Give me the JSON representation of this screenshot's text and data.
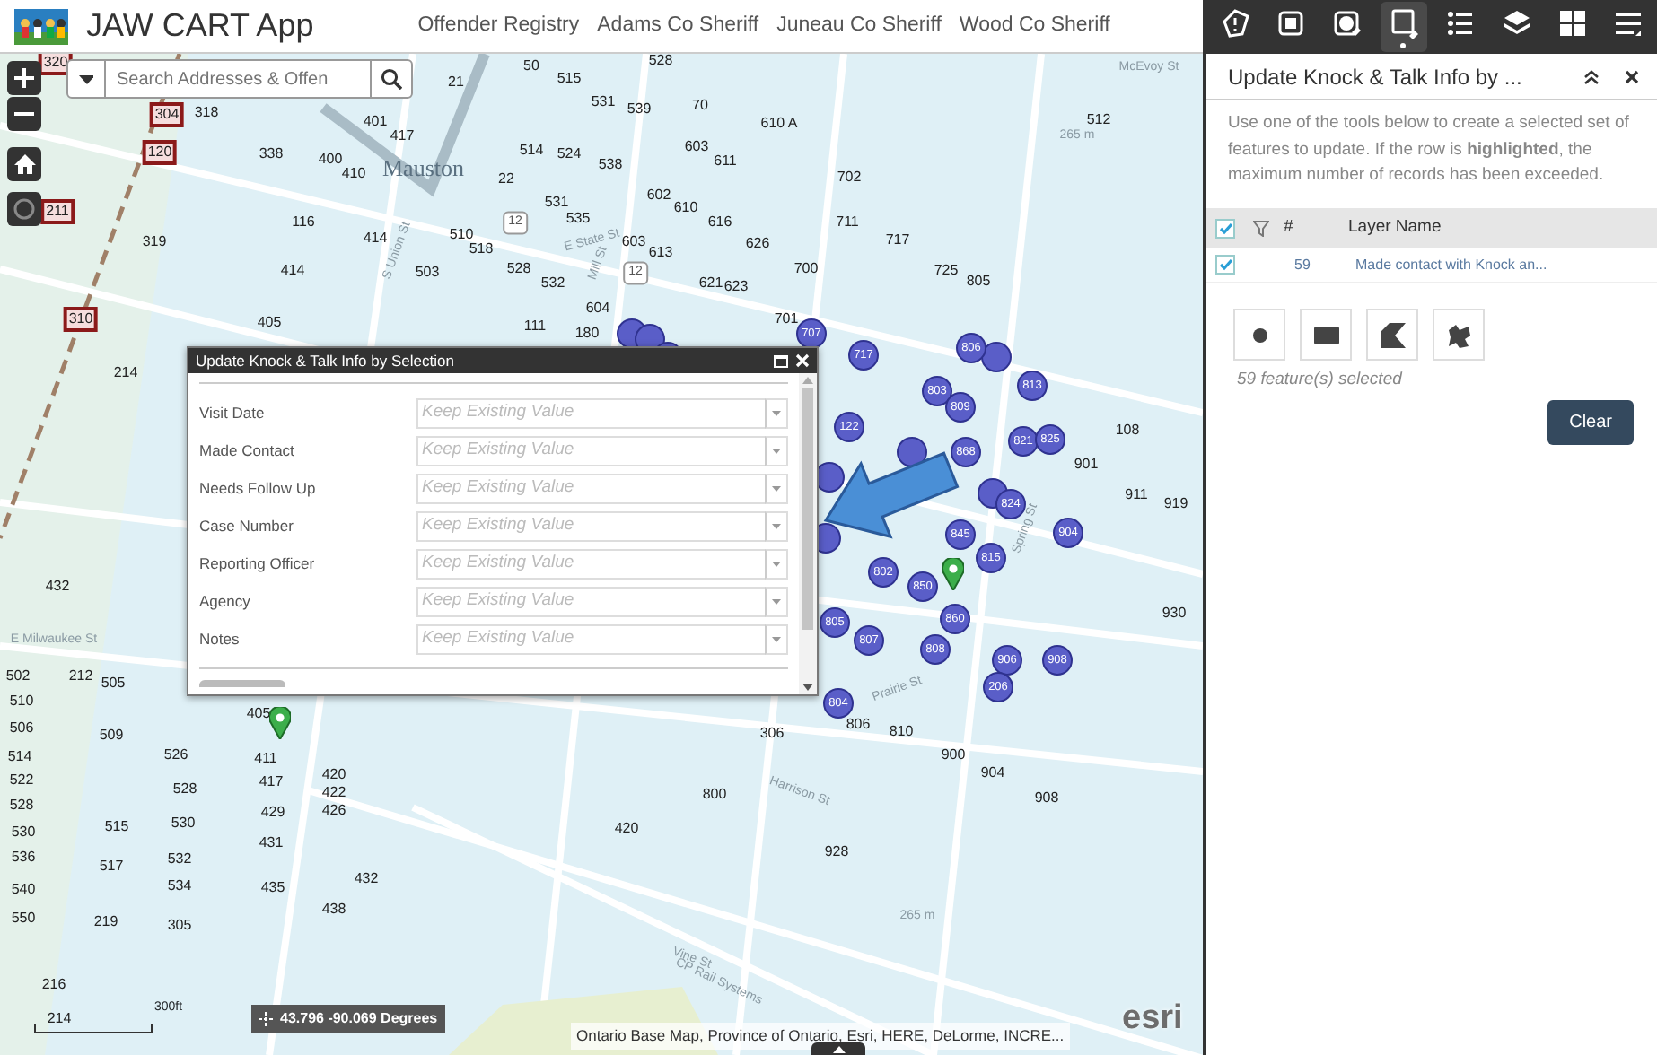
{
  "header": {
    "app_title": "JAW CART App",
    "links": [
      "Offender Registry",
      "Adams Co Sheriff",
      "Juneau Co Sheriff",
      "Wood Co Sheriff"
    ]
  },
  "search": {
    "placeholder": "Search Addresses & Offen"
  },
  "map": {
    "place_label": "Mauston",
    "parcel_labels": [
      "50",
      "515",
      "528",
      "21",
      "531",
      "539",
      "70",
      "610 A",
      "512",
      "318",
      "401",
      "417",
      "338",
      "400",
      "410",
      "514",
      "524",
      "538",
      "603",
      "611",
      "22",
      "702",
      "602",
      "610",
      "531",
      "535",
      "319",
      "116",
      "414",
      "510",
      "518",
      "616",
      "711",
      "414",
      "503",
      "528",
      "603",
      "613",
      "626",
      "717",
      "532",
      "621",
      "623",
      "700",
      "725",
      "805",
      "405",
      "111",
      "604",
      "180",
      "701",
      "214",
      "108",
      "901",
      "911",
      "919",
      "930",
      "432",
      "502",
      "212",
      "505",
      "510",
      "506",
      "509",
      "514",
      "522",
      "528",
      "530",
      "536",
      "540",
      "550",
      "526",
      "528",
      "530",
      "532",
      "534",
      "305",
      "515",
      "517",
      "219",
      "405",
      "411",
      "417",
      "420",
      "422",
      "429",
      "426",
      "431",
      "435",
      "432",
      "438",
      "420",
      "800",
      "306",
      "806",
      "810",
      "900",
      "904",
      "908",
      "928",
      "216",
      "214"
    ],
    "boxed_labels": [
      "320",
      "304",
      "120",
      "211",
      "310"
    ],
    "marker_labels": [
      "707",
      "717",
      "806",
      "803",
      "809",
      "813",
      "821",
      "825",
      "122",
      "868",
      "824",
      "845",
      "815",
      "802",
      "850",
      "860",
      "805",
      "807",
      "808",
      "906",
      "908",
      "206",
      "804",
      "904"
    ],
    "street_labels": [
      "McEvoy St",
      "E State St",
      "S Union St",
      "Mill St",
      "E Milwaukee St",
      "Prairie St",
      "Harrison St",
      "Vine St",
      "CP Rail Systems",
      "Spring St"
    ],
    "contour_labels": [
      "265 m",
      "265 m"
    ],
    "highway_shields": [
      "12",
      "12"
    ],
    "scale": "300ft",
    "coordinates": "43.796 -90.069 Degrees",
    "attribution": "Ontario Base Map, Province of Ontario, Esri, HERE, DeLorme, INCRE...",
    "logo": "esri"
  },
  "popup": {
    "title": "Update Knock & Talk Info by Selection",
    "fields": [
      {
        "label": "Visit Date",
        "placeholder": "Keep Existing Value"
      },
      {
        "label": "Made Contact",
        "placeholder": "Keep Existing Value"
      },
      {
        "label": "Needs Follow Up",
        "placeholder": "Keep Existing Value"
      },
      {
        "label": "Case Number",
        "placeholder": "Keep Existing Value"
      },
      {
        "label": "Reporting Officer",
        "placeholder": "Keep Existing Value"
      },
      {
        "label": "Agency",
        "placeholder": "Keep Existing Value"
      },
      {
        "label": "Notes",
        "placeholder": "Keep Existing Value"
      }
    ]
  },
  "toolbar": [
    {
      "kind": "about",
      "selected": false
    },
    {
      "kind": "edit",
      "selected": false
    },
    {
      "kind": "select",
      "selected": false
    },
    {
      "kind": "update",
      "selected": true
    },
    {
      "kind": "legend",
      "selected": false
    },
    {
      "kind": "layers",
      "selected": false
    },
    {
      "kind": "grid",
      "selected": false
    },
    {
      "kind": "list",
      "selected": false
    }
  ],
  "panel": {
    "title": "Update Knock & Talk Info by ...",
    "description": "Use one of the tools below to create a selected set of features to update. If the row is **highlighted**, the maximum number of records has been exceeded.",
    "table": {
      "header_checked": true,
      "columns": [
        "#",
        "Layer Name"
      ],
      "rows": [
        {
          "checked": true,
          "count": "59",
          "layer": "Made contact with Knock an..."
        }
      ]
    },
    "tools": [
      {
        "kind": "point"
      },
      {
        "kind": "rectangle"
      },
      {
        "kind": "polygon"
      },
      {
        "kind": "freehand"
      }
    ],
    "status": "59 feature(s) selected",
    "clear_button": "Clear"
  }
}
